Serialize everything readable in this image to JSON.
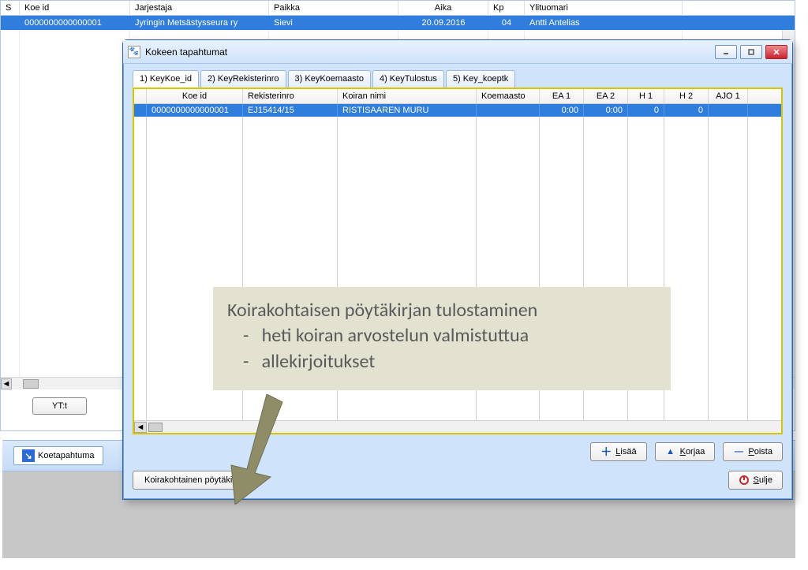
{
  "bg_window": {
    "headers": {
      "s": "S",
      "koe_id": "Koe id",
      "jarjestaja": "Jarjestaja",
      "paikka": "Paikka",
      "aika": "Aika",
      "kp": "Kp",
      "ylituomari": "Ylituomari"
    },
    "row": {
      "koe_id": "0000000000000001",
      "jarjestaja": "Jyringin Metsästysseura ry",
      "paikka": "Sievi",
      "aika": "20.09.2016",
      "kp": "04",
      "ylituomari": "Antti Antelias"
    },
    "yt_btn": "YT:t"
  },
  "taskbar": {
    "label": "Koetapahtuma"
  },
  "dialog": {
    "title": "Kokeen tapahtumat",
    "tabs": [
      "1) KeyKoe_id",
      "2) KeyRekisterinro",
      "3) KeyKoemaasto",
      "4) KeyTulostus",
      "5) Key_koeptk"
    ],
    "grid_headers": {
      "koe_id": "Koe id",
      "rekisterinro": "Rekisterinro",
      "koiran_nimi": "Koiran nimi",
      "koemaasto": "Koemaasto",
      "ea1": "EA 1",
      "ea2": "EA 2",
      "h1": "H 1",
      "h2": "H 2",
      "ajo1": "AJO 1"
    },
    "grid_row": {
      "koe_id": "0000000000000001",
      "rekisterinro": "EJ15414/15",
      "koiran_nimi": "RISTISAAREN MURU",
      "koemaasto": "",
      "ea1": "0:00",
      "ea2": "0:00",
      "h1": "0",
      "h2": "0"
    },
    "buttons": {
      "lisaa": "Lisää",
      "korjaa": "Korjaa",
      "poista": "Poista",
      "sulje": "Sulje",
      "koirakohtainen": "Koirakohtainen pöytäkirja"
    }
  },
  "annotation": {
    "title": "Koirakohtaisen pöytäkirjan tulostaminen",
    "b1": "heti koiran arvostelun valmistuttua",
    "b2": "allekirjoitukset"
  }
}
